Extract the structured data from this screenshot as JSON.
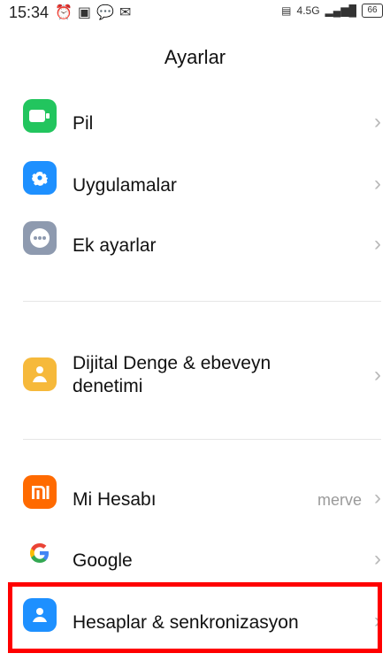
{
  "status_bar": {
    "time": "15:34",
    "left_icons": [
      "alarm-icon",
      "nfc-icon",
      "message-icon",
      "gmail-icon"
    ],
    "network": "4.5G",
    "battery": "66"
  },
  "page": {
    "title": "Ayarlar"
  },
  "items": [
    {
      "label": "Pil",
      "icon": "battery-icon",
      "color": "#22c55e"
    },
    {
      "label": "Uygulamalar",
      "icon": "gear-icon",
      "color": "#1e90ff"
    },
    {
      "label": "Ek ayarlar",
      "icon": "more-icon",
      "color": "#8e9aaf"
    },
    {
      "label_line1": "Dijital Denge & ebeveyn",
      "label_line2": "denetimi",
      "icon": "family-icon",
      "color": "#f6b93b"
    },
    {
      "label": "Mi Hesabı",
      "value": "merve",
      "icon": "mi-icon",
      "color": "#ff6a00"
    },
    {
      "label": "Google",
      "icon": "google-icon",
      "color": "#4285F4"
    },
    {
      "label": "Hesaplar & senkronizasyon",
      "icon": "account-icon",
      "color": "#1e90ff"
    }
  ],
  "chevron": "›"
}
